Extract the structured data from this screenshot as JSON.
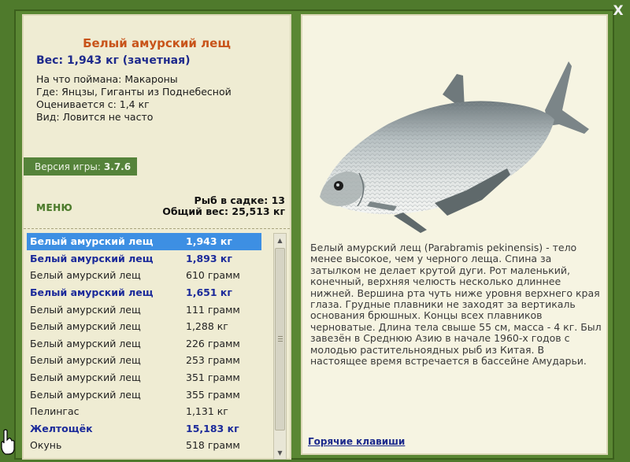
{
  "window": {
    "close_label": "X"
  },
  "info": {
    "title": "Белый амурский лещ",
    "weight": "Вес: 1,943 кг (зачетная)",
    "details": [
      "На что поймана: Макароны",
      "Где: Янцзы, Гиганты из Поднебесной",
      "Оценивается с: 1,4 кг",
      "Вид: Ловится не часто"
    ],
    "version_label": "Версия игры:",
    "version_value": "3.7.6",
    "menu_label": "МЕНЮ",
    "fish_count": "Рыб в садке: 13",
    "total_weight": "Общий вес: 25,513 кг"
  },
  "fish_list": [
    {
      "name": "Белый амурский лещ",
      "weight": "1,943 кг",
      "style": "selected"
    },
    {
      "name": "Белый амурский лещ",
      "weight": "1,893 кг",
      "style": "trophy"
    },
    {
      "name": "Белый амурский лещ",
      "weight": "610 грамм",
      "style": "normal"
    },
    {
      "name": "Белый амурский лещ",
      "weight": "1,651 кг",
      "style": "trophy"
    },
    {
      "name": "Белый амурский лещ",
      "weight": "111 грамм",
      "style": "normal"
    },
    {
      "name": "Белый амурский лещ",
      "weight": "1,288 кг",
      "style": "normal"
    },
    {
      "name": "Белый амурский лещ",
      "weight": "226 грамм",
      "style": "normal"
    },
    {
      "name": "Белый амурский лещ",
      "weight": "253 грамм",
      "style": "normal"
    },
    {
      "name": "Белый амурский лещ",
      "weight": "351 грамм",
      "style": "normal"
    },
    {
      "name": "Белый амурский лещ",
      "weight": "355 грамм",
      "style": "normal"
    },
    {
      "name": "Пелингас",
      "weight": "1,131 кг",
      "style": "normal"
    },
    {
      "name": "Желтощёк",
      "weight": "15,183 кг",
      "style": "trophy"
    },
    {
      "name": "Окунь",
      "weight": "518 грамм",
      "style": "normal"
    }
  ],
  "description": "Белый амурский лещ (Parabramis pekinensis) - тело менее высокое, чем у черного леща. Спина за затылком не делает крутой дуги. Рот маленький, конечный, верхняя челюсть несколько длиннее нижней. Вершина рта чуть ниже уровня верхнего края глаза. Грудные плавники не заходят за вертикаль основания брюшных. Концы всех плавников черноватые. Длина тела свыше 55 см, масса - 4 кг. Был завезён в Среднюю Азию в начале 1960-х годов с молодью растительноядных рыб из Китая. В настоящее время встречается в бассейне Амударьи.",
  "hotkeys_label": "Горячие клавиши",
  "colors": {
    "background": "#4f7a2c",
    "panel": "#efecd3",
    "title": "#c8541a",
    "trophy": "#1b2a9a",
    "selected": "#3d8fe3",
    "version_bar": "#55833a"
  },
  "icons": [
    "close-icon",
    "fish-image",
    "scroll-up-arrow",
    "scroll-down-arrow",
    "hand-cursor-icon"
  ]
}
